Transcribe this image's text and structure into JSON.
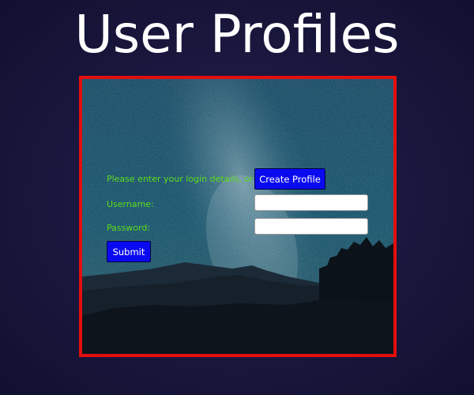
{
  "page": {
    "title": "User Profiles"
  },
  "login": {
    "prompt": "Please enter your login details, or",
    "create_profile_label": "Create Profile",
    "username_label": "Username:",
    "username_value": "",
    "password_label": "Password:",
    "password_value": "",
    "submit_label": "Submit"
  },
  "colors": {
    "frame_border": "#e40e0e",
    "label_text": "#5ddc1a",
    "button_bg": "#0a0af0",
    "page_bg": "#1c1840"
  },
  "background_image": {
    "subject": "night-sky-milky-way-mountains"
  }
}
